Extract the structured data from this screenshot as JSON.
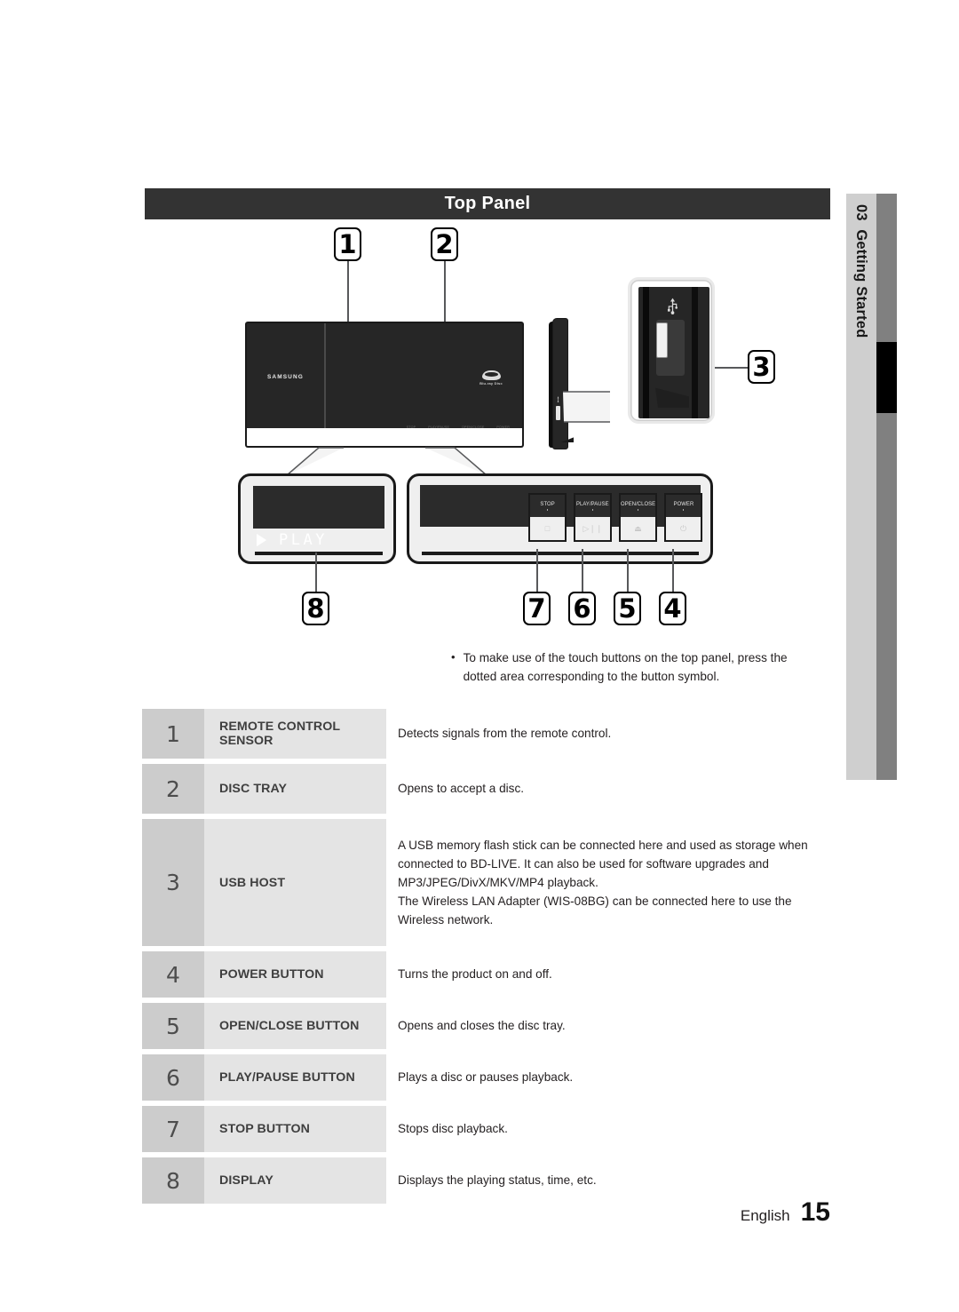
{
  "section": {
    "title": "Top Panel"
  },
  "chapter_tab": {
    "number": "03",
    "label": "Getting Started"
  },
  "callouts": [
    {
      "id": "1",
      "number": "1"
    },
    {
      "id": "2",
      "number": "2"
    },
    {
      "id": "3",
      "number": "3"
    },
    {
      "id": "4",
      "number": "4"
    },
    {
      "id": "5",
      "number": "5"
    },
    {
      "id": "6",
      "number": "6"
    },
    {
      "id": "7",
      "number": "7"
    },
    {
      "id": "8",
      "number": "8"
    }
  ],
  "device": {
    "brand": "SAMSUNG",
    "disc_logo": "Blu-ray Disc",
    "panel_touch_labels": [
      "STOP",
      "PLAY/PAUSE",
      "OPEN/CLOSE",
      "POWER"
    ]
  },
  "display_inset": {
    "play_icon": "play-triangle-icon",
    "text": "PLAY"
  },
  "button_inset": {
    "buttons": [
      {
        "label": "STOP",
        "symbol": "□"
      },
      {
        "label": "PLAY/PAUSE",
        "symbol": "▷❘❘"
      },
      {
        "label": "OPEN/CLOSE",
        "symbol": "⏏"
      },
      {
        "label": "POWER",
        "symbol": "⏻"
      }
    ]
  },
  "usb_inset": {
    "icon": "usb-icon"
  },
  "note": {
    "bullet": "•",
    "text": "To make use of the touch buttons on the top panel, press the dotted area corresponding to the button symbol."
  },
  "spec_table": {
    "rows": [
      {
        "num": "1",
        "name": "REMOTE CONTROL SENSOR",
        "desc": "Detects signals from the remote control."
      },
      {
        "num": "2",
        "name": "DISC TRAY",
        "desc": "Opens to accept a disc."
      },
      {
        "num": "3",
        "name": "USB HOST",
        "desc": "A USB memory flash stick can be connected here and used as storage when connected to BD-LIVE. It can also be used for software upgrades and MP3/JPEG/DivX/MKV/MP4 playback.\nThe Wireless LAN Adapter (WIS-08BG) can be connected here to use the Wireless network."
      },
      {
        "num": "4",
        "name": "POWER BUTTON",
        "desc": "Turns the product on and off."
      },
      {
        "num": "5",
        "name": "OPEN/CLOSE BUTTON",
        "desc": "Opens and closes the disc tray."
      },
      {
        "num": "6",
        "name": "PLAY/PAUSE BUTTON",
        "desc": "Plays a disc or pauses playback."
      },
      {
        "num": "7",
        "name": "STOP BUTTON",
        "desc": "Stops disc playback."
      },
      {
        "num": "8",
        "name": "DISPLAY",
        "desc": "Displays the playing status, time, etc."
      }
    ]
  },
  "footer": {
    "language": "English",
    "page": "15"
  },
  "colors": {
    "header_bg": "#333333",
    "tab_light": "#cfcfcf",
    "tab_gray": "#808080",
    "tab_active": "#000000",
    "row_num_bg": "#cccccc",
    "row_name_bg": "#e4e4e4",
    "text": "#231f20"
  }
}
